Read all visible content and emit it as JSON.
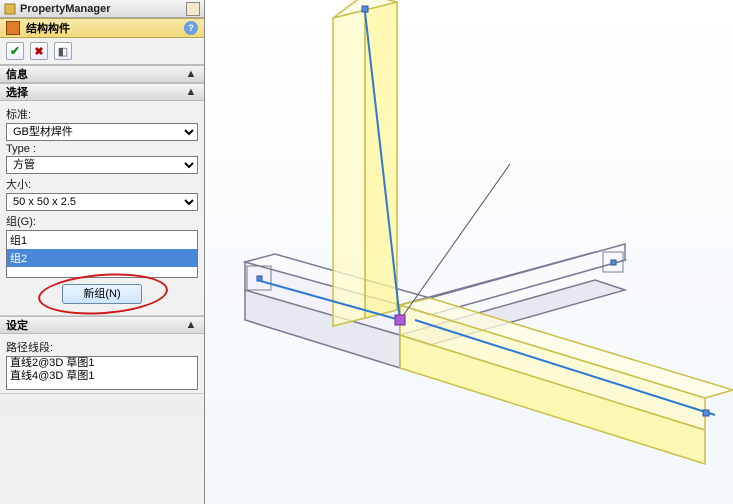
{
  "title": "PropertyManager",
  "header": {
    "title": "结构构件",
    "help": "?"
  },
  "okrow": {
    "ok_tip": "确定",
    "cancel_tip": "取消",
    "pin_tip": "固定"
  },
  "info": {
    "title": "信息",
    "chev": "▲"
  },
  "select": {
    "title": "选择",
    "chev": "▲",
    "standard_label": "标准:",
    "standard_value": "GB型材焊件",
    "type_label": "Type :",
    "type_value": "方管",
    "size_label": "大小:",
    "size_value": "50 x 50 x 2.5",
    "group_label": "组(G):",
    "groups": [
      "组1",
      "组2"
    ],
    "new_group_label": "新组(N)"
  },
  "settings": {
    "title": "设定",
    "chev": "▲"
  },
  "paths": {
    "label": "路径线段:",
    "items": [
      "直线2@3D 草图1",
      "直线4@3D 草图1"
    ]
  }
}
